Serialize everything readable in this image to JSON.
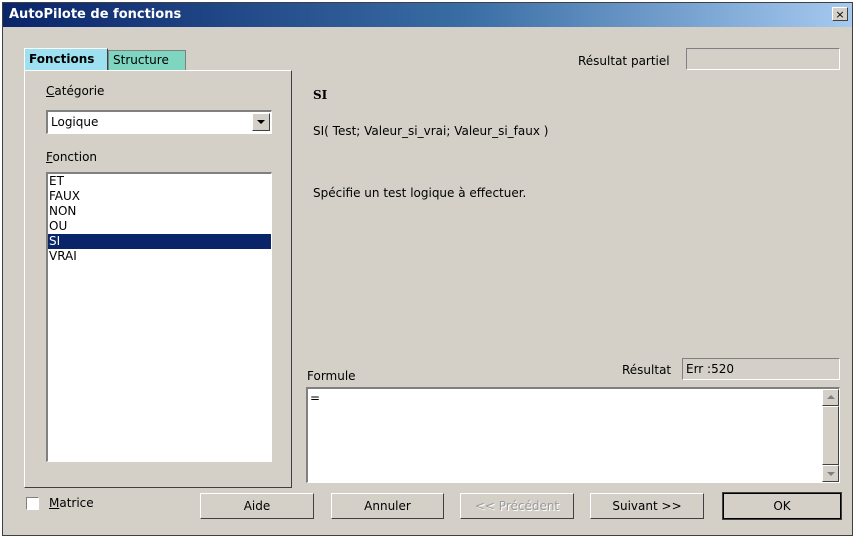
{
  "window": {
    "title": "AutoPilote de fonctions",
    "close_glyph": "×"
  },
  "tabs": [
    {
      "label": "Fonctions"
    },
    {
      "label": "Structure"
    }
  ],
  "partial_result": {
    "label": "Résultat partiel",
    "value": ""
  },
  "category": {
    "label": "Catégorie",
    "selected": "Logique"
  },
  "function_list": {
    "label": "Fonction",
    "items": [
      "ET",
      "FAUX",
      "NON",
      "OU",
      "SI",
      "VRAI"
    ],
    "selected": "SI"
  },
  "function_info": {
    "name": "SI",
    "syntax": "SI( Test; Valeur_si_vrai; Valeur_si_faux )",
    "description": "Spécifie un test logique à effectuer."
  },
  "formula": {
    "label": "Formule",
    "value": "="
  },
  "result": {
    "label": "Résultat",
    "value": "Err :520"
  },
  "matrix": {
    "label": "Matrice",
    "checked": false
  },
  "buttons": {
    "help": "Aide",
    "cancel": "Annuler",
    "previous": "<< Précédent",
    "next": "Suivant >>",
    "ok": "OK"
  }
}
